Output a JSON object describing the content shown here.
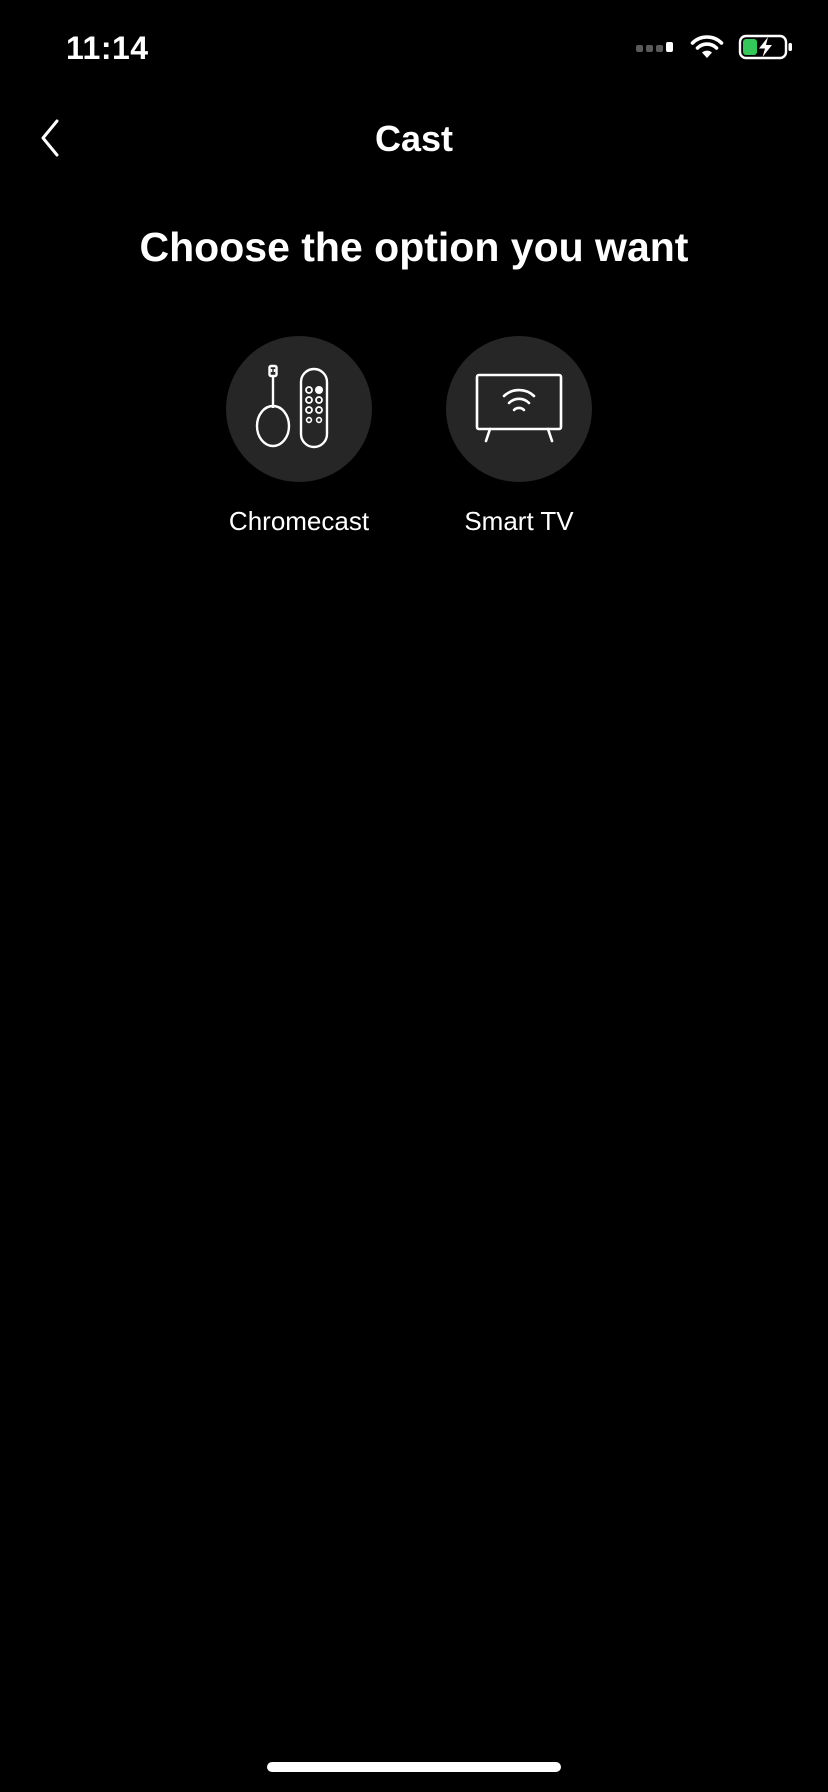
{
  "status_bar": {
    "time": "11:14",
    "icons": [
      "cellular-signal-icon",
      "wifi-icon",
      "battery-charging-icon"
    ]
  },
  "nav": {
    "title": "Cast",
    "back_icon": "chevron-left-icon"
  },
  "main": {
    "heading": "Choose the option you want",
    "options": [
      {
        "label": "Chromecast",
        "icon": "chromecast-remote-icon"
      },
      {
        "label": "Smart TV",
        "icon": "smart-tv-icon"
      }
    ]
  },
  "colors": {
    "background": "#000000",
    "option_circle": "#262626",
    "text": "#ffffff",
    "battery_charge": "#34c759"
  }
}
